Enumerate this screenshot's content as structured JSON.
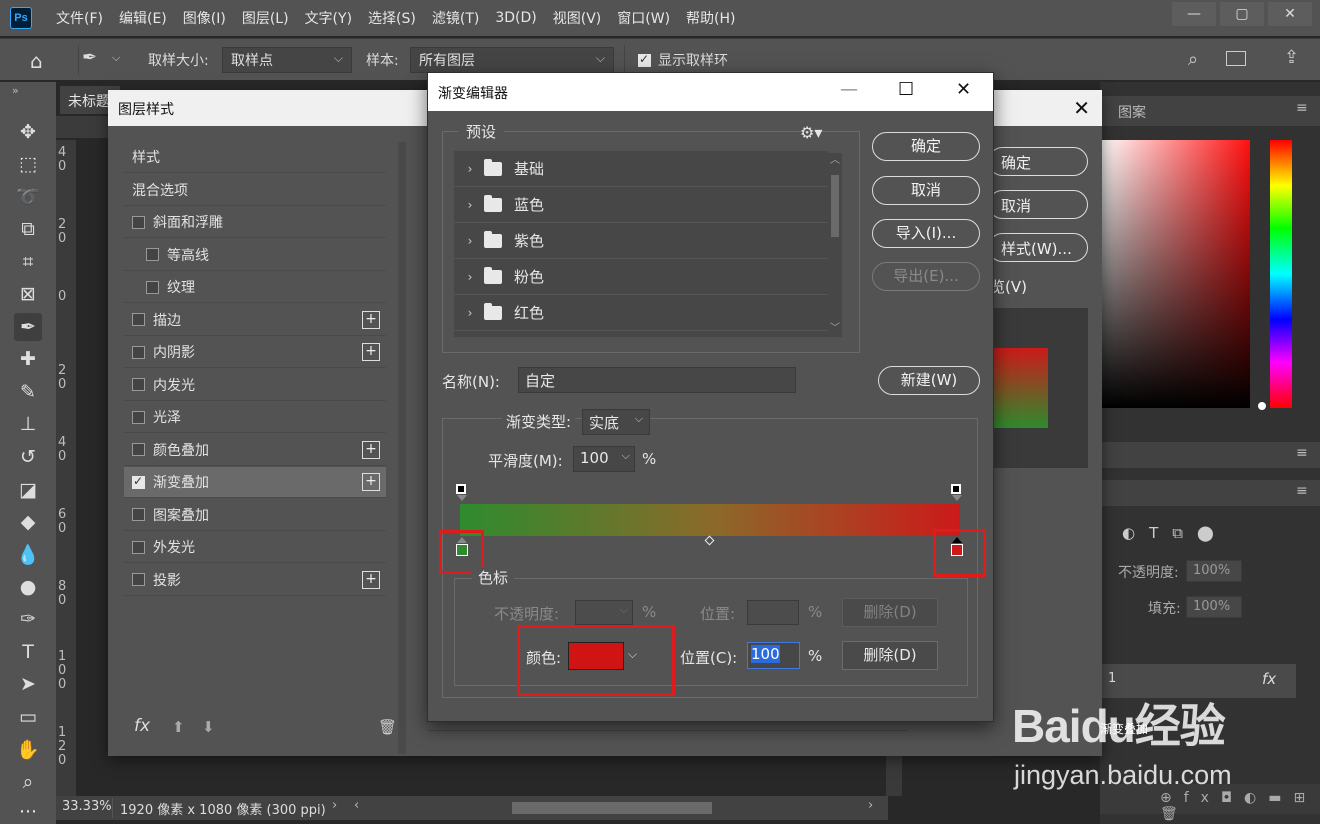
{
  "app": {
    "logo": "Ps"
  },
  "menu": [
    "文件(F)",
    "编辑(E)",
    "图像(I)",
    "图层(L)",
    "文字(Y)",
    "选择(S)",
    "滤镜(T)",
    "3D(D)",
    "视图(V)",
    "窗口(W)",
    "帮助(H)"
  ],
  "window_controls": {
    "minimize": "—",
    "restore": "▢",
    "close": "✕"
  },
  "options": {
    "sample_size_label": "取样大小:",
    "sample_size_value": "取样点",
    "sample_label": "样本:",
    "sample_value": "所有图层",
    "show_ring_label": "显示取样环",
    "show_ring_checked": true
  },
  "document": {
    "tab_label": "未标题",
    "ruler_numbers": [
      "4\n0",
      "2\n0",
      "0",
      "2\n0",
      "4\n0",
      "6\n0",
      "8\n0",
      "1\n0\n0",
      "1\n2\n0"
    ],
    "zoom": "33.33%",
    "doc_info": "1920 像素 x 1080 像素 (300 ppi)"
  },
  "layer_style": {
    "title": "图层样式",
    "close": "✕",
    "items": [
      {
        "label": "样式",
        "checkbox": false,
        "plus": false,
        "indent": 0,
        "selected": false,
        "checked": false
      },
      {
        "label": "混合选项",
        "checkbox": false,
        "plus": false,
        "indent": 0,
        "selected": false,
        "checked": false
      },
      {
        "label": "斜面和浮雕",
        "checkbox": true,
        "plus": false,
        "indent": 0,
        "selected": false,
        "checked": false
      },
      {
        "label": "等高线",
        "checkbox": true,
        "plus": false,
        "indent": 1,
        "selected": false,
        "checked": false
      },
      {
        "label": "纹理",
        "checkbox": true,
        "plus": false,
        "indent": 1,
        "selected": false,
        "checked": false
      },
      {
        "label": "描边",
        "checkbox": true,
        "plus": true,
        "indent": 0,
        "selected": false,
        "checked": false
      },
      {
        "label": "内阴影",
        "checkbox": true,
        "plus": true,
        "indent": 0,
        "selected": false,
        "checked": false
      },
      {
        "label": "内发光",
        "checkbox": true,
        "plus": false,
        "indent": 0,
        "selected": false,
        "checked": false
      },
      {
        "label": "光泽",
        "checkbox": true,
        "plus": false,
        "indent": 0,
        "selected": false,
        "checked": false
      },
      {
        "label": "颜色叠加",
        "checkbox": true,
        "plus": true,
        "indent": 0,
        "selected": false,
        "checked": false
      },
      {
        "label": "渐变叠加",
        "checkbox": true,
        "plus": true,
        "indent": 0,
        "selected": true,
        "checked": true
      },
      {
        "label": "图案叠加",
        "checkbox": true,
        "plus": false,
        "indent": 0,
        "selected": false,
        "checked": false
      },
      {
        "label": "外发光",
        "checkbox": true,
        "plus": false,
        "indent": 0,
        "selected": false,
        "checked": false
      },
      {
        "label": "投影",
        "checkbox": true,
        "plus": true,
        "indent": 0,
        "selected": false,
        "checked": false
      }
    ],
    "footer_fx": "fx",
    "right_buttons": [
      "确定",
      "取消",
      "样式(W)...",
      "览(V)"
    ]
  },
  "gradient_editor": {
    "title": "渐变编辑器",
    "presets_label": "预设",
    "presets": [
      "基础",
      "蓝色",
      "紫色",
      "粉色",
      "红色"
    ],
    "buttons": {
      "ok": "确定",
      "cancel": "取消",
      "import": "导入(I)...",
      "export": "导出(E)...",
      "new": "新建(W)"
    },
    "name_label": "名称(N):",
    "name_value": "自定",
    "gradient_type_label": "渐变类型:",
    "gradient_type_value": "实底",
    "smoothness_label": "平滑度(M):",
    "smoothness_value": "100",
    "percent": "%",
    "gradient_colors": {
      "start": "#2e8b2e",
      "end": "#cc1a1a"
    },
    "color_stops_label": "色标",
    "opacity_label": "不透明度:",
    "position_label_top": "位置:",
    "delete_top": "删除(D)",
    "color_label": "颜色:",
    "color_value": "#d01414",
    "position_label": "位置(C):",
    "position_value": "100",
    "delete_bottom": "删除(D)"
  },
  "right_panel": {
    "tab": "图案",
    "opacity_label": "不透明度:",
    "opacity_value": "100%",
    "fill_label": "填充:",
    "fill_value": "100%",
    "layer_name": "1",
    "fx": "fx"
  },
  "watermark": {
    "logo": "Baidu经验",
    "sub": "jingyan.baidu.com",
    "small": "渐变叠加"
  }
}
